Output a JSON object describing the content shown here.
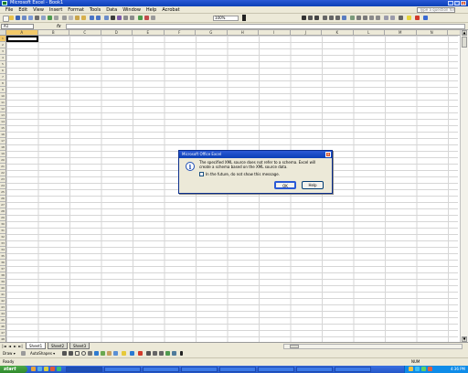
{
  "window": {
    "title": "Microsoft Excel - Book1",
    "minimize_label": "_",
    "maximize_label": "□",
    "close_label": "x"
  },
  "menu": {
    "items": [
      "File",
      "Edit",
      "View",
      "Insert",
      "Format",
      "Tools",
      "Data",
      "Window",
      "Help",
      "Acrobat"
    ],
    "help_placeholder": "Type a question for help"
  },
  "toolbar": {
    "zoom": "100%"
  },
  "formula_bar": {
    "name_box": "A1",
    "fx_label": "fx",
    "value": ""
  },
  "grid": {
    "columns": [
      "A",
      "B",
      "C",
      "D",
      "E",
      "F",
      "G",
      "H",
      "I",
      "J",
      "K",
      "L",
      "M",
      "N",
      "O",
      "P",
      "Q",
      "R",
      "S"
    ],
    "rows": [
      "1",
      "2",
      "3",
      "4",
      "5",
      "6",
      "7",
      "8",
      "9",
      "10",
      "11",
      "12",
      "13",
      "14",
      "15",
      "16",
      "17",
      "18",
      "19",
      "20",
      "21",
      "22",
      "23",
      "24",
      "25",
      "26",
      "27",
      "28",
      "29",
      "30",
      "31",
      "32",
      "33",
      "34",
      "35",
      "36",
      "37",
      "38",
      "39",
      "40",
      "41",
      "42",
      "43",
      "44",
      "45",
      "46",
      "47",
      "48"
    ],
    "active_cell": "A1"
  },
  "sheet_tabs": {
    "tabs": [
      "Sheet1",
      "Sheet2",
      "Sheet3"
    ],
    "active": "Sheet1",
    "nav": [
      "|◄",
      "◄",
      "►",
      "►|"
    ]
  },
  "drawing_toolbar": {
    "draw_label": "Draw ▾",
    "autoshapes_label": "AutoShapes ▾"
  },
  "status_bar": {
    "status": "Ready",
    "num_indicator": "NUM"
  },
  "taskbar": {
    "start_label": "start",
    "clock": "4:36 PM",
    "buttons": [
      "",
      "",
      "",
      "",
      "",
      "",
      "",
      ""
    ]
  },
  "dialog": {
    "title": "Microsoft Office Excel",
    "message": "The specified XML source does not refer to a schema. Excel will create a schema based on the XML source data.",
    "checkbox_label": "In the future, do not show this message.",
    "checked": false,
    "ok_label": "OK",
    "help_label": "Help",
    "close_label": "x",
    "icon": "info-icon"
  },
  "colors": {
    "titlebar": "#0a3fb6",
    "chrome": "#ece9d8",
    "active_header": "#f3c969",
    "start_button": "#2f8a2c"
  }
}
